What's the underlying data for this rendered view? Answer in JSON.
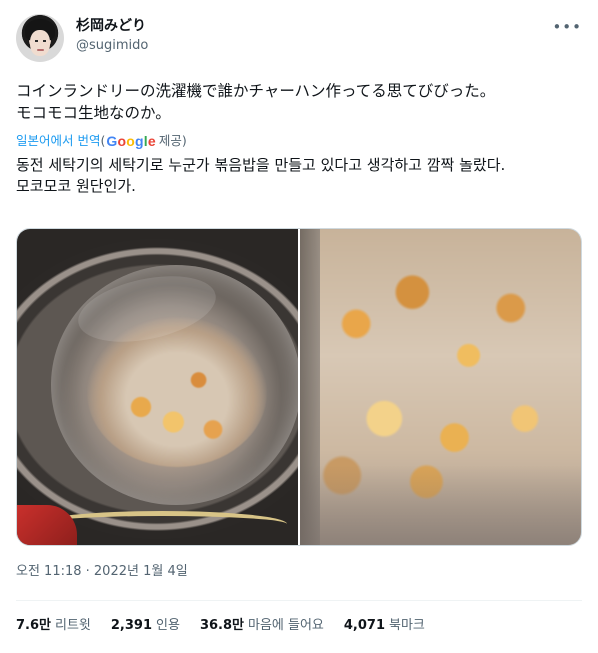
{
  "user": {
    "display_name": "杉岡みどり",
    "handle": "@sugimido"
  },
  "more_icon": "more-horizontal-icon",
  "tweet": {
    "text": "コインランドリーの洗濯機で誰かチャーハン作ってる思てびびった。\nモコモコ生地なのか。"
  },
  "translation": {
    "from_label": "일본어에서 번역",
    "paren_open": "(",
    "google_letters": [
      "G",
      "o",
      "o",
      "g",
      "l",
      "e"
    ],
    "provided": "제공)",
    "text": "동전 세탁기의 세탁기로 누군가 볶음밥을 만들고 있다고 생각하고 깜짝 놀랐다.\n모코모코 원단인가."
  },
  "timestamp": "오전 11:18 · 2022년 1월 4일",
  "stats": [
    {
      "num": "7.6만",
      "label": "리트윗"
    },
    {
      "num": "2,391",
      "label": "인용"
    },
    {
      "num": "36.8만",
      "label": "마음에 들어요"
    },
    {
      "num": "4,071",
      "label": "북마크"
    }
  ]
}
